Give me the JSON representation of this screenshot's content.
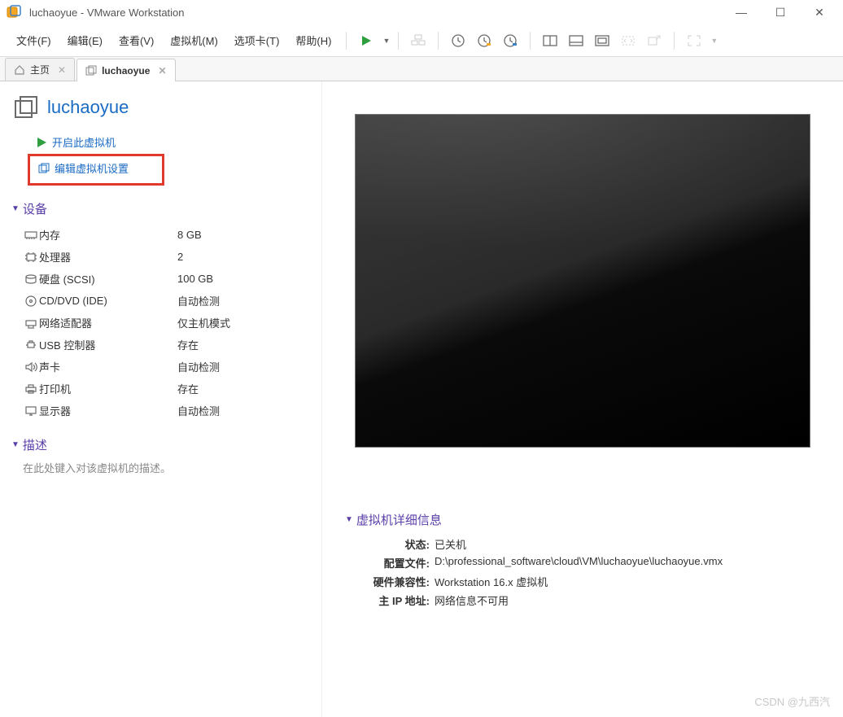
{
  "window": {
    "title": "luchaoyue - VMware Workstation"
  },
  "menus": [
    "文件(F)",
    "编辑(E)",
    "查看(V)",
    "虚拟机(M)",
    "选项卡(T)",
    "帮助(H)"
  ],
  "tabs": {
    "home": "主页",
    "vm": "luchaoyue"
  },
  "vm": {
    "name": "luchaoyue"
  },
  "actions": {
    "power_on": "开启此虚拟机",
    "edit_settings": "编辑虚拟机设置"
  },
  "sections": {
    "devices": "设备",
    "description": "描述",
    "details": "虚拟机详细信息"
  },
  "devices": [
    {
      "icon": "memory",
      "name": "内存",
      "value": "8 GB"
    },
    {
      "icon": "cpu",
      "name": "处理器",
      "value": "2"
    },
    {
      "icon": "hdd",
      "name": "硬盘 (SCSI)",
      "value": "100 GB"
    },
    {
      "icon": "cd",
      "name": "CD/DVD (IDE)",
      "value": "自动检测"
    },
    {
      "icon": "net",
      "name": "网络适配器",
      "value": "仅主机模式"
    },
    {
      "icon": "usb",
      "name": "USB 控制器",
      "value": "存在"
    },
    {
      "icon": "sound",
      "name": "声卡",
      "value": "自动检测"
    },
    {
      "icon": "printer",
      "name": "打印机",
      "value": "存在"
    },
    {
      "icon": "display",
      "name": "显示器",
      "value": "自动检测"
    }
  ],
  "description_placeholder": "在此处键入对该虚拟机的描述。",
  "details": {
    "state_k": "状态:",
    "state_v": "已关机",
    "config_k": "配置文件:",
    "config_v": "D:\\professional_software\\cloud\\VM\\luchaoyue\\luchaoyue.vmx",
    "compat_k": "硬件兼容性:",
    "compat_v": "Workstation 16.x 虚拟机",
    "ip_k": "主 IP 地址:",
    "ip_v": "网络信息不可用"
  },
  "watermark": "CSDN @九西汽"
}
